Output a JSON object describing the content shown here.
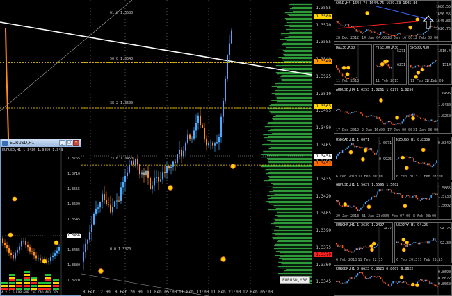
{
  "main": {
    "symbol_tag": "EURUSD,M30",
    "price_ticks": [
      "1.3585",
      "1.3570",
      "1.3555",
      "1.3540",
      "1.3525",
      "1.3510",
      "1.3495",
      "1.3480",
      "1.3465",
      "1.3450",
      "1.3435",
      "1.3420",
      "1.3405",
      "1.3390",
      "1.3375",
      "1.3360",
      "1.3345"
    ],
    "price_tags": [
      {
        "label": "1.3580",
        "color": "#ffd400"
      },
      {
        "label": "1.3540",
        "color": "#ff9a00"
      },
      {
        "label": "1.3505",
        "color": "#ffd400"
      },
      {
        "label": "1.3458",
        "color": "#ffffff"
      },
      {
        "label": "1.3452",
        "color": "#ff6a00"
      },
      {
        "label": "1.3370",
        "color": "#ff2020"
      }
    ],
    "fib_labels": [
      "61.8 1.3580",
      "50.0 1.3540",
      "38.2 1.3500",
      "23.6 1.3450",
      "0.0 1.3370"
    ],
    "time_labels": [
      "8 Feb 12:00",
      "8 Feb 20:00",
      "11 Feb 05:00",
      "11 Feb 13:00",
      "11 Feb 21:00",
      "12 Feb 05:00"
    ]
  },
  "window": {
    "title": "EURUSD,H1",
    "info": "EURUSD,H1  1.3436 1.3459 1.343",
    "btn_min": "_",
    "btn_max": "□",
    "btn_close": "×",
    "price_ticks": [
      "1.3765",
      "1.3710",
      "1.3655",
      "1.3600",
      "1.3545",
      "1.3490",
      "1.3435",
      "1.3380",
      "1.3270"
    ],
    "price_tag": "1.3456",
    "meter_labels": [
      "4.2",
      "7.6",
      "EUR",
      "GBP",
      "CHF",
      "CAD",
      "AUD",
      "JPY"
    ]
  },
  "minis": [
    {
      "title": "GOLD,H4  1644.74 1644.75 1639.33 1645.86",
      "scale": [
        "1686.55",
        "1656.55",
        "1645.86",
        "1626.75"
      ],
      "times": [
        "28 Dec 2012",
        "14 Jan 04:00",
        "28 Jan 16:00",
        "12 Feb 00:00"
      ]
    },
    {
      "title": "DAX30,M30",
      "scale": [],
      "times": [
        "11 Feb 2013"
      ]
    },
    {
      "title": "FTSE100,M30",
      "scale": [
        "6271",
        "6251"
      ],
      "times": [
        "11 Feb 2013"
      ]
    },
    {
      "title": "SP500,M30",
      "scale": [
        "1516.4",
        "1514"
      ],
      "times": [
        "11 Feb 2013",
        "12 Feb 09"
      ]
    },
    {
      "title": "AUDUSD,H4  1.0253 1.0261 1.0277 1.0250",
      "scale": [
        "1.0495",
        "1.0430",
        "1.0250"
      ],
      "times": [
        "17 Dec 2012",
        "2 Jan 16:00",
        "17 Jan 00:00",
        "31 Jan 08:00"
      ]
    },
    {
      "title": "USDCAD,H1  1.0071",
      "scale": [
        "1.0071",
        "0.9925"
      ],
      "times": [
        "6 Feb 2013",
        "11 Feb 00:00"
      ]
    },
    {
      "title": "NZDUSD,H1  0.8339",
      "scale": [
        "0.8349"
      ],
      "times": [
        "6 Feb 2013",
        "11 Feb 03:00"
      ]
    },
    {
      "title": "GBPUSD,H1  1.5627 1.5596 1.5602",
      "scale": [
        "1.5865",
        "1.5730",
        "1.5602"
      ],
      "times": [
        "29 Jan 2013",
        "31 Jan 23:00",
        "5 Feb 07:00",
        "8 Feb 08:00"
      ]
    },
    {
      "title": "EURCHF,H1  1.2639 1.2427",
      "scale": [
        "1.2427"
      ],
      "times": [
        "6 Feb 2013",
        "11 Feb 22:15"
      ]
    },
    {
      "title": "USDJPY,H1  94.26",
      "scale": [
        "94.25",
        "92.30"
      ],
      "times": [
        "6 Feb 2013",
        "11 Feb 23:15"
      ]
    },
    {
      "title": "EURGBP,H1  0.8623 0.8623 0.8607 0.8622",
      "scale": [
        "0.8690",
        "0.8622",
        "0.8560"
      ],
      "times": []
    }
  ]
}
